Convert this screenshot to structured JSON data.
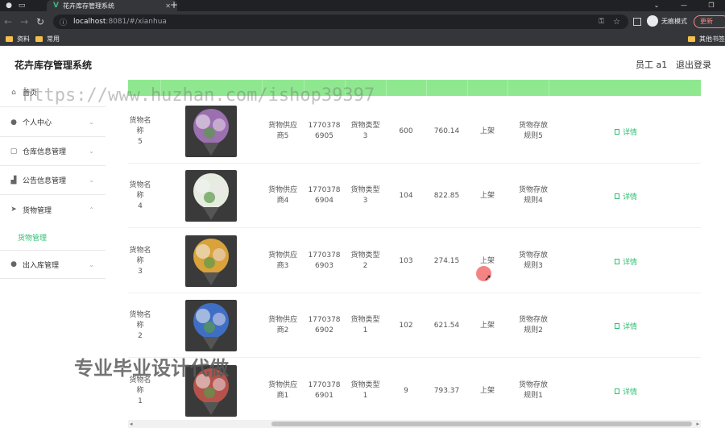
{
  "browser": {
    "tab_title": "花卉库存管理系统",
    "url_host": "localhost",
    "url_path": ":8081/#/xianhua",
    "incognito_label": "无痕模式",
    "update_label": "更新",
    "bookmarks": [
      "资料",
      "常用"
    ],
    "other_bookmarks": "其他书签"
  },
  "header": {
    "title": "花卉库存管理系统",
    "user": "员工 a1",
    "logout": "退出登录"
  },
  "sidebar": {
    "items": [
      {
        "label": "首页",
        "icon": "home-icon"
      },
      {
        "label": "个人中心",
        "icon": "user-icon"
      },
      {
        "label": "仓库信息管理",
        "icon": "window-icon"
      },
      {
        "label": "公告信息管理",
        "icon": "chart-icon"
      },
      {
        "label": "货物管理",
        "icon": "send-icon"
      },
      {
        "label": "出入库管理",
        "icon": "user-icon"
      }
    ],
    "active_sub": "货物管理"
  },
  "table": {
    "rows": [
      {
        "name1": "货物名称",
        "name2": "5",
        "supplier1": "货物供应",
        "supplier2": "商5",
        "phone1": "1770378",
        "phone2": "6905",
        "type1": "货物类型",
        "type2": "3",
        "qty": "600",
        "price": "760.14",
        "status": "上架",
        "rule1": "货物存放",
        "rule2": "规则5",
        "action": "详情",
        "thumb_color": "#9b6fb0"
      },
      {
        "name1": "货物名称",
        "name2": "4",
        "supplier1": "货物供应",
        "supplier2": "商4",
        "phone1": "1770378",
        "phone2": "6904",
        "type1": "货物类型",
        "type2": "3",
        "qty": "104",
        "price": "822.85",
        "status": "上架",
        "rule1": "货物存放",
        "rule2": "规则4",
        "action": "详情",
        "thumb_color": "#e6ece0"
      },
      {
        "name1": "货物名称",
        "name2": "3",
        "supplier1": "货物供应",
        "supplier2": "商3",
        "phone1": "1770378",
        "phone2": "6903",
        "type1": "货物类型",
        "type2": "2",
        "qty": "103",
        "price": "274.15",
        "status": "上架",
        "rule1": "货物存放",
        "rule2": "规则3",
        "action": "详情",
        "thumb_color": "#d9a23a"
      },
      {
        "name1": "货物名称",
        "name2": "2",
        "supplier1": "货物供应",
        "supplier2": "商2",
        "phone1": "1770378",
        "phone2": "6902",
        "type1": "货物类型",
        "type2": "1",
        "qty": "102",
        "price": "621.54",
        "status": "上架",
        "rule1": "货物存放",
        "rule2": "规则2",
        "action": "详情",
        "thumb_color": "#3f6fc4"
      },
      {
        "name1": "货物名称",
        "name2": "1",
        "supplier1": "货物供应",
        "supplier2": "商1",
        "phone1": "1770378",
        "phone2": "6901",
        "type1": "货物类型",
        "type2": "1",
        "qty": "9",
        "price": "793.37",
        "status": "上架",
        "rule1": "货物存放",
        "rule2": "规则1",
        "action": "详情",
        "thumb_color": "#b5524a"
      }
    ]
  },
  "watermarks": {
    "url": "https://www.huzhan.com/ishop39397",
    "text": "专业毕业设计代做"
  },
  "colors": {
    "accent": "#2fbf71",
    "header_green": "#8fe88f"
  }
}
